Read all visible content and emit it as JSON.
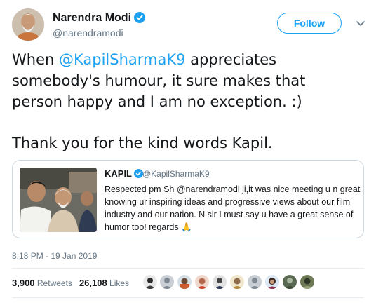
{
  "author": {
    "name": "Narendra Modi",
    "handle": "@narendramodi",
    "follow_label": "Follow"
  },
  "tweet": {
    "text_intro": "When ",
    "mention": "@KapilSharmaK9",
    "text_line1_rest": " appreciates",
    "text_line2": "somebody's humour, it sure makes that",
    "text_line3": "person happy and I am no exception. :)",
    "text_line4": "Thank you for the kind words Kapil."
  },
  "quoted_tweet": {
    "name": "KAPIL",
    "handle": "@KapilSharmaK9",
    "text": "Respected pm Sh @narendramodi ji,it was nice meeting u n great knowing ur inspiring ideas and progressive views about our film industry and our nation. N sir I must say u have a great sense of humor too! regards 🙏"
  },
  "timestamp": "8:18 PM - 19 Jan 2019",
  "stats": {
    "retweets_count": "3,900",
    "retweets_label": "Retweets",
    "likes_count": "26,108",
    "likes_label": "Likes"
  },
  "colors": {
    "accent": "#1da1f2",
    "text": "#14171a",
    "muted": "#657786",
    "border": "#ccd6dd"
  },
  "icons": [
    "verified-badge-icon",
    "chevron-down-icon"
  ]
}
